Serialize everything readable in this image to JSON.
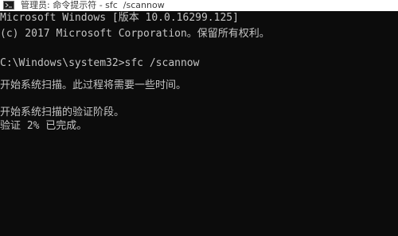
{
  "window": {
    "title": "管理员: 命令提示符 - sfc  /scannow",
    "icon": "console-icon"
  },
  "console": {
    "lines": [
      "Microsoft Windows [版本 10.0.16299.125]",
      "(c) 2017 Microsoft Corporation。保留所有权利。",
      "",
      "C:\\Windows\\system32>sfc /scannow",
      "",
      "开始系统扫描。此过程将需要一些时间。",
      "",
      "开始系统扫描的验证阶段。",
      "验证 2% 已完成。"
    ]
  },
  "colors": {
    "background": "#0c0c0c",
    "text": "#c4c4c4",
    "titlebar": "#ffffff"
  }
}
